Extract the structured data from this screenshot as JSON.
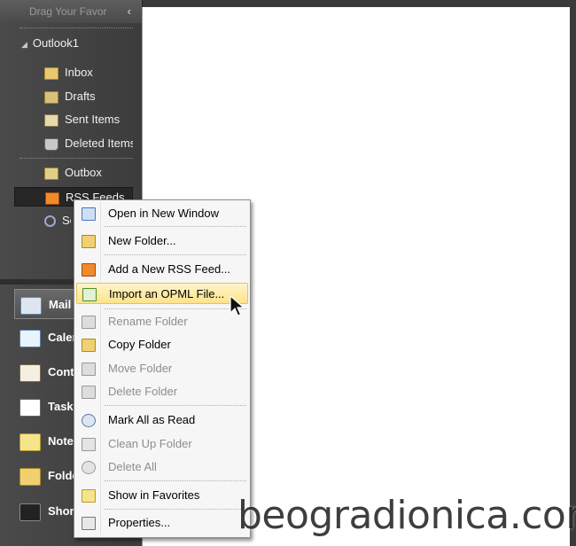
{
  "nav": {
    "header_text": "Drag Your Favor",
    "account": "Outlook1",
    "folders": [
      {
        "label": "Inbox",
        "icon": "inbox-icon"
      },
      {
        "label": "Drafts",
        "icon": "drafts-icon"
      },
      {
        "label": "Sent Items",
        "icon": "sent-items-icon"
      },
      {
        "label": "Deleted Items",
        "icon": "deleted-items-icon"
      },
      {
        "label": "Outbox",
        "icon": "outbox-icon"
      },
      {
        "label": "RSS Feeds",
        "icon": "rss-icon",
        "selected": true
      },
      {
        "label": "Search Folders",
        "icon": "search-folder-icon"
      }
    ],
    "buttons": [
      {
        "label": "Mail",
        "icon": "mail-icon",
        "active": true
      },
      {
        "label": "Calendar",
        "icon": "calendar-icon"
      },
      {
        "label": "Contacts",
        "icon": "contacts-icon"
      },
      {
        "label": "Tasks",
        "icon": "tasks-icon"
      },
      {
        "label": "Notes",
        "icon": "notes-icon"
      },
      {
        "label": "Folder List",
        "icon": "folder-list-icon"
      },
      {
        "label": "Shortcuts",
        "icon": "shortcuts-icon"
      }
    ]
  },
  "context_menu": {
    "items": [
      {
        "label": "Open in New Window",
        "icon": "new-window-icon",
        "enabled": true
      },
      {
        "label": "New Folder...",
        "icon": "new-folder-icon",
        "enabled": true
      },
      {
        "label": "Add a New RSS Feed...",
        "icon": "rss-add-icon",
        "enabled": true
      },
      {
        "label": "Import an OPML File...",
        "icon": "opml-import-icon",
        "enabled": true,
        "highlighted": true
      },
      {
        "label": "Rename Folder",
        "icon": "rename-folder-icon",
        "enabled": false
      },
      {
        "label": "Copy Folder",
        "icon": "copy-folder-icon",
        "enabled": true
      },
      {
        "label": "Move Folder",
        "icon": "move-folder-icon",
        "enabled": false
      },
      {
        "label": "Delete Folder",
        "icon": "delete-folder-icon",
        "enabled": false
      },
      {
        "label": "Mark All as Read",
        "icon": "mark-read-icon",
        "enabled": true
      },
      {
        "label": "Clean Up Folder",
        "icon": "clean-up-icon",
        "enabled": false
      },
      {
        "label": "Delete All",
        "icon": "delete-all-icon",
        "enabled": false
      },
      {
        "label": "Show in Favorites",
        "icon": "favorites-icon",
        "enabled": true
      },
      {
        "label": "Properties...",
        "icon": "properties-icon",
        "enabled": true
      }
    ]
  },
  "watermark": "beogradionica.com",
  "colors": {
    "highlight_top": "#fff4c8",
    "highlight_bottom": "#fde38a",
    "nav_background": "#4a4a4a"
  }
}
